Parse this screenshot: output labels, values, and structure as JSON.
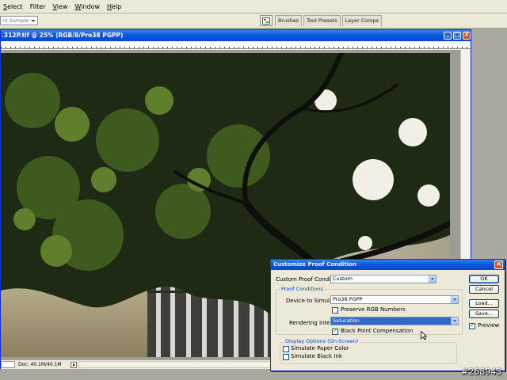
{
  "menu": {
    "items": [
      {
        "label": "Select",
        "underline": "S",
        "rest": "elect"
      },
      {
        "label": "Filter",
        "underline": "",
        "rest": "Filter"
      },
      {
        "label": "View",
        "underline": "V",
        "rest": "iew"
      },
      {
        "label": "Window",
        "underline": "W",
        "rest": "indow"
      },
      {
        "label": "Help",
        "underline": "H",
        "rest": "elp"
      }
    ]
  },
  "options_bar": {
    "sample_select": "nt Sample",
    "palette_tabs": [
      "Brushes",
      "Tool Presets",
      "Layer Comps"
    ]
  },
  "document": {
    "title": ".312P.tif @ 25% (RGB/8/Pro38 PGPP)",
    "status_doc": "Doc: 40.1M/40.1M"
  },
  "dialog": {
    "title": "Customize Proof Condition",
    "custom_label": "Custom Proof Condition:",
    "custom_value": "Custom",
    "proof_group": "Proof Conditions",
    "device_label": "Device to Simulate:",
    "device_value": "Pro38 PGPP",
    "preserve_rgb": "Preserve RGB Numbers",
    "preserve_rgb_checked": false,
    "intent_label": "Rendering Intent:",
    "intent_value": "Saturation",
    "black_point": "Black Point Compensation",
    "black_point_checked": true,
    "display_group": "Display Options (On-Screen)",
    "sim_paper": "Simulate Paper Color",
    "sim_paper_checked": false,
    "sim_ink": "Simulate Black Ink",
    "sim_ink_checked": false,
    "buttons": {
      "ok": "OK",
      "cancel": "Cancel",
      "load": "Load...",
      "save": "Save..."
    },
    "preview": "Preview",
    "preview_checked": true
  },
  "watermark": "#268943",
  "colors": {
    "titlebar": "#0a58e0",
    "dialog_bg": "#ece9d8",
    "selection": "#316ac5"
  }
}
